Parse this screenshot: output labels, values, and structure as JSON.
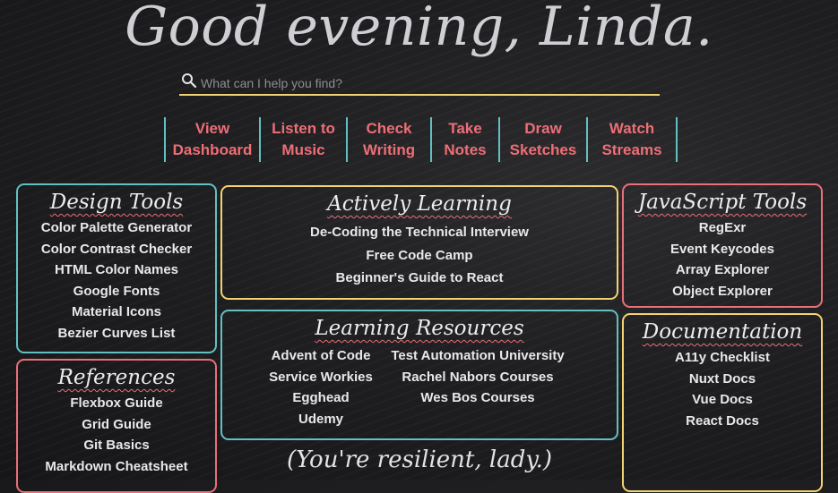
{
  "greeting": "Good evening, Linda.",
  "search": {
    "placeholder": "What can I help you find?"
  },
  "nav": [
    {
      "line1": "View",
      "line2": "Dashboard"
    },
    {
      "line1": "Listen to",
      "line2": "Music"
    },
    {
      "line1": "Check",
      "line2": "Writing"
    },
    {
      "line1": "Take",
      "line2": "Notes"
    },
    {
      "line1": "Draw",
      "line2": "Sketches"
    },
    {
      "line1": "Watch",
      "line2": "Streams"
    }
  ],
  "design_tools": {
    "title": "Design Tools",
    "links": [
      "Color Palette Generator",
      "Color Contrast Checker",
      "HTML Color Names",
      "Google Fonts",
      "Material Icons",
      "Bezier Curves List"
    ]
  },
  "references": {
    "title": "References",
    "links": [
      "Flexbox Guide",
      "Grid Guide",
      "Git Basics",
      "Markdown Cheatsheet"
    ]
  },
  "actively_learning": {
    "title": "Actively Learning",
    "links": [
      "De-Coding the Technical Interview",
      "Free Code Camp",
      "Beginner's Guide to React"
    ]
  },
  "learning_resources": {
    "title": "Learning Resources",
    "left": [
      "Advent of Code",
      "Service Workies",
      "Egghead",
      "Udemy"
    ],
    "right": [
      "Test Automation University",
      "Rachel Nabors Courses",
      "Wes Bos Courses"
    ]
  },
  "javascript_tools": {
    "title": "JavaScript Tools",
    "links": [
      "RegExr",
      "Event Keycodes",
      "Array Explorer",
      "Object Explorer"
    ]
  },
  "documentation": {
    "title": "Documentation",
    "links": [
      "A11y Checklist",
      "Nuxt Docs",
      "Vue Docs",
      "React Docs"
    ]
  },
  "quote": "(You're resilient, lady.)",
  "colors": {
    "teal": "#62c0c2",
    "yellow": "#f2d272",
    "pink": "#e96f7a",
    "nav_text": "#ee6e76"
  }
}
